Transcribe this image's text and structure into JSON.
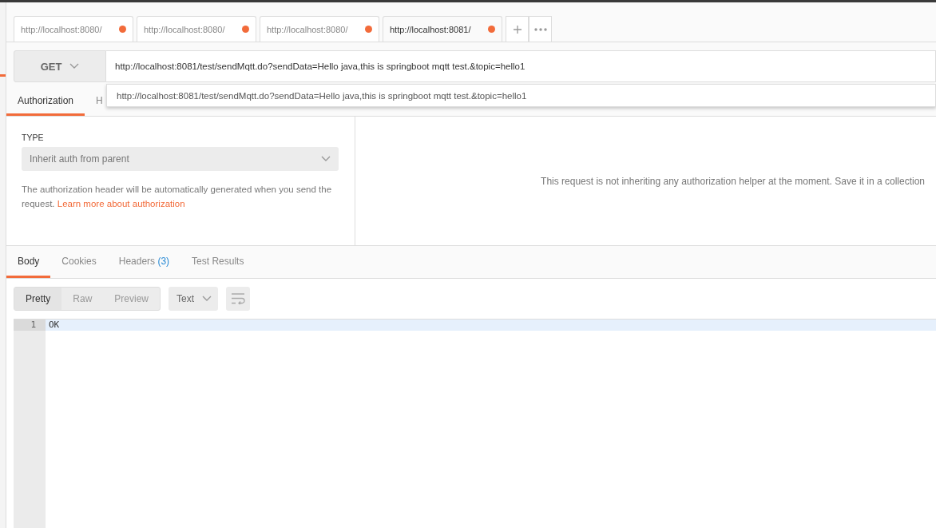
{
  "request_tabs": [
    {
      "label": "http://localhost:8080/",
      "selected": false,
      "unsaved": true
    },
    {
      "label": "http://localhost:8080/",
      "selected": false,
      "unsaved": true
    },
    {
      "label": "http://localhost:8080/",
      "selected": false,
      "unsaved": true
    },
    {
      "label": "http://localhost:8081/",
      "selected": true,
      "unsaved": true
    }
  ],
  "method": "GET",
  "url": "http://localhost:8081/test/sendMqtt.do?sendData=Hello java,this is springboot mqtt test.&topic=hello1",
  "suggestions": [
    "http://localhost:8081/test/sendMqtt.do?sendData=Hello java,this is springboot mqtt test.&topic=hello1"
  ],
  "request_sections": [
    {
      "label": "Authorization",
      "selected": true
    },
    {
      "label": "H",
      "selected": false
    }
  ],
  "auth": {
    "type_label": "TYPE",
    "type_value": "Inherit auth from parent",
    "help": "The authorization header will be automatically generated when you send the request.",
    "help_link": "Learn more about authorization",
    "message": "This request is not inheriting any authorization helper at the moment. Save it in a collection"
  },
  "response_tabs": [
    {
      "label": "Body",
      "selected": true
    },
    {
      "label": "Cookies",
      "selected": false
    },
    {
      "label": "Headers",
      "count": "(3)",
      "selected": false
    },
    {
      "label": "Test Results",
      "selected": false
    }
  ],
  "view_modes": [
    {
      "label": "Pretty",
      "selected": true
    },
    {
      "label": "Raw",
      "selected": false
    },
    {
      "label": "Preview",
      "selected": false
    }
  ],
  "format": "Text",
  "body_lines": [
    {
      "number": "1",
      "text": "OK",
      "highlighted": true
    }
  ]
}
